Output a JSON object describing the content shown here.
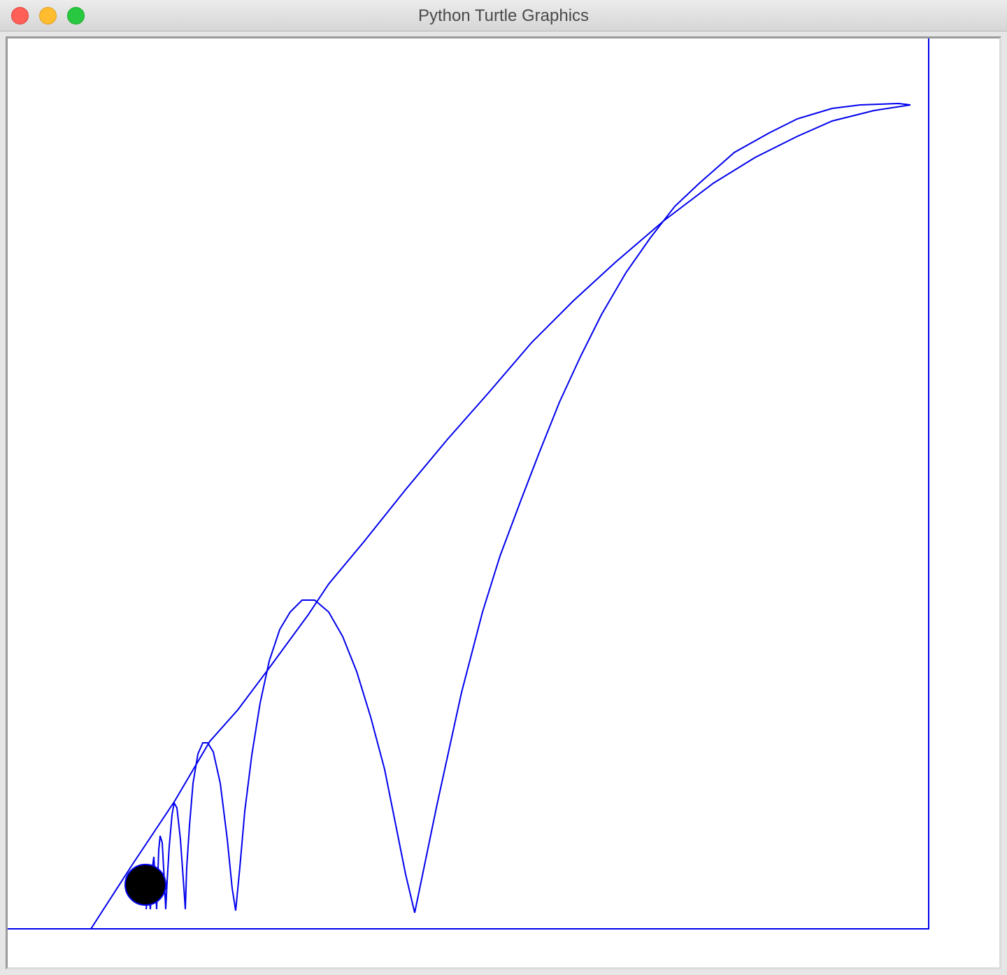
{
  "window": {
    "title": "Python Turtle Graphics"
  },
  "canvas": {
    "background": "#ffffff",
    "line_color": "#0000ee",
    "ball_fill": "#000000",
    "ball_outline": "#0000ee"
  }
}
